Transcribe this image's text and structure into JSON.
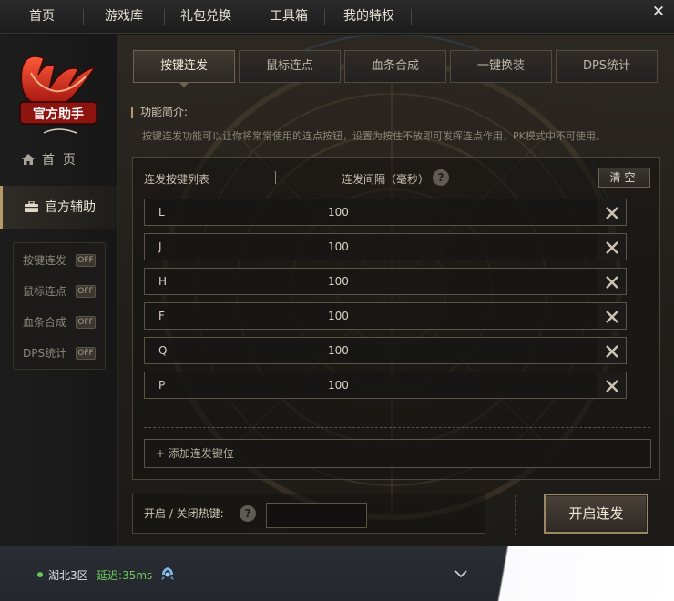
{
  "nav": {
    "items": [
      "首页",
      "游戏库",
      "礼包兑换",
      "工具箱",
      "我的特权"
    ],
    "close": "✕"
  },
  "sidebar": {
    "logo_text": "官方助手",
    "home": "首  页",
    "assist": "官方辅助",
    "sub_items": [
      {
        "label": "按键连发",
        "badge": "OFF"
      },
      {
        "label": "鼠标连点",
        "badge": "OFF"
      },
      {
        "label": "血条合成",
        "badge": "OFF"
      },
      {
        "label": "DPS统计",
        "badge": "OFF"
      }
    ]
  },
  "tabs": [
    "按键连发",
    "鼠标连点",
    "血条合成",
    "一键换装",
    "DPS统计"
  ],
  "intro": {
    "title": "功能简介:",
    "text": "按键连发功能可以让你将常常使用的连点按钮，设置为按住不放即可发挥连点作用，PK模式中不可使用。"
  },
  "list": {
    "col_keys": "连发按键列表",
    "col_interval": "连发间隔（毫秒）",
    "help": "?",
    "clear": "清空",
    "rows": [
      {
        "key": "L",
        "interval": "100"
      },
      {
        "key": "J",
        "interval": "100"
      },
      {
        "key": "H",
        "interval": "100"
      },
      {
        "key": "F",
        "interval": "100"
      },
      {
        "key": "Q",
        "interval": "100"
      },
      {
        "key": "P",
        "interval": "100"
      }
    ],
    "add": "+ 添加连发键位"
  },
  "hotkey": {
    "label": "开启 / 关闭热键:",
    "help": "?",
    "value": ""
  },
  "start_button": "开启连发",
  "status": {
    "server": "湖北3区",
    "latency": "延迟:35ms"
  },
  "colors": {
    "accent": "#b69a6a",
    "online": "#69c356",
    "latency": "#6fcc5c",
    "panel_border": "#5a5346"
  }
}
